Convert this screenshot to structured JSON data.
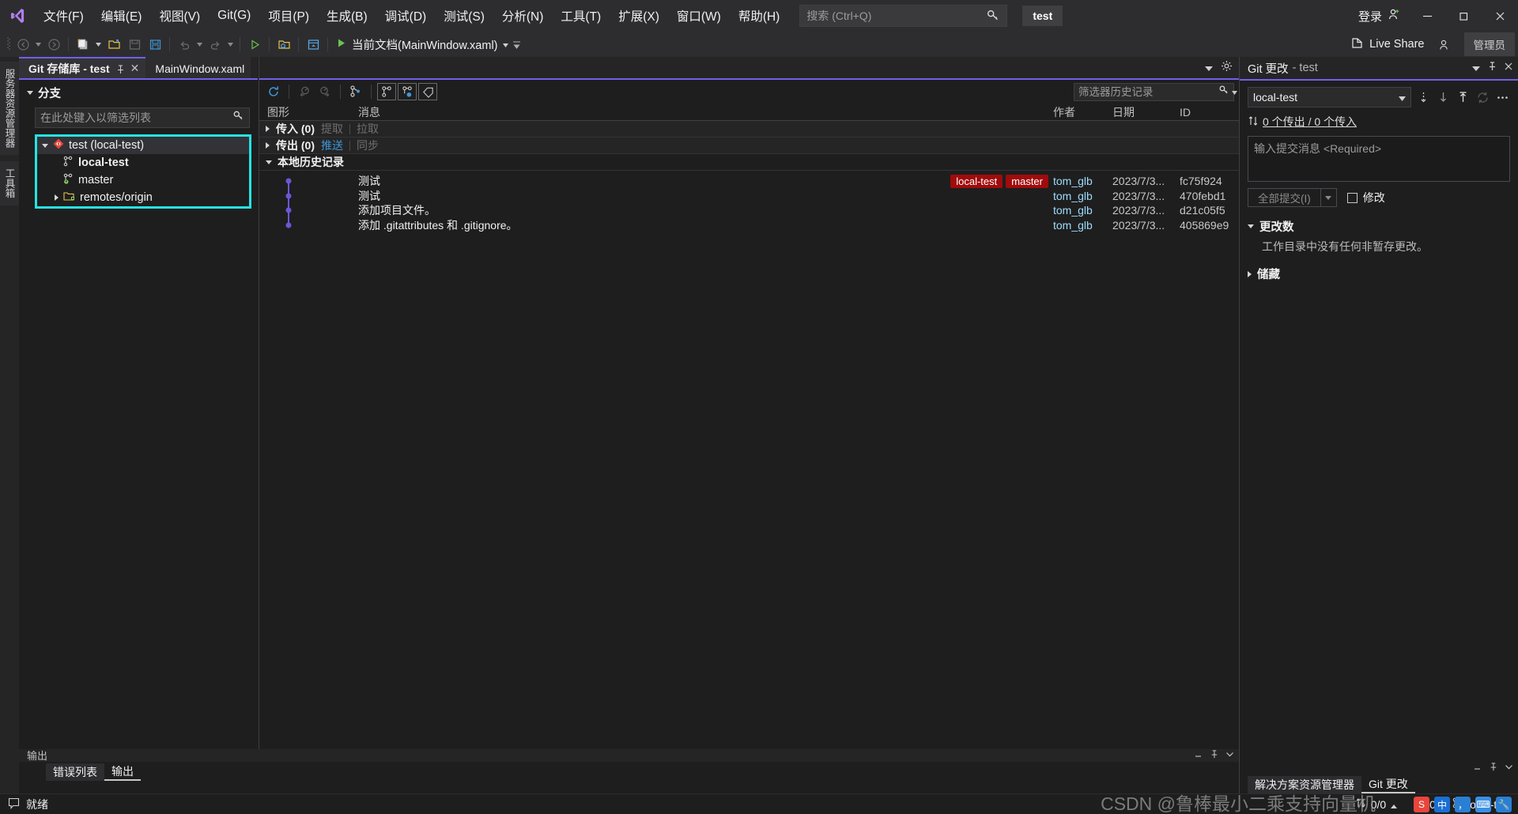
{
  "app": {
    "logo_icon": "visual-studio-logo",
    "project_chip": "test",
    "signin_label": "登录",
    "admin_label": "管理员",
    "live_share_label": "Live Share"
  },
  "menu": {
    "items": [
      {
        "label": "文件(F)"
      },
      {
        "label": "编辑(E)"
      },
      {
        "label": "视图(V)"
      },
      {
        "label": "Git(G)"
      },
      {
        "label": "项目(P)"
      },
      {
        "label": "生成(B)"
      },
      {
        "label": "调试(D)"
      },
      {
        "label": "测试(S)"
      },
      {
        "label": "分析(N)"
      },
      {
        "label": "工具(T)"
      },
      {
        "label": "扩展(X)"
      },
      {
        "label": "窗口(W)"
      },
      {
        "label": "帮助(H)"
      }
    ]
  },
  "search": {
    "placeholder": "搜索 (Ctrl+Q)",
    "value": "",
    "icon": "search-key-icon"
  },
  "window_controls": {
    "minimize": "minimize-icon",
    "restore": "restore-icon",
    "close": "close-icon"
  },
  "toolbar": {
    "startup_project": "当前文档(MainWindow.xaml)",
    "icons": [
      "navigate-back-icon",
      "navigate-forward-icon",
      "new-project-icon",
      "open-file-icon",
      "save-icon",
      "save-all-icon",
      "undo-icon",
      "redo-icon",
      "start-debug-icon",
      "folder-search-icon",
      "window-icon"
    ]
  },
  "vertical_dock": {
    "tabs": [
      "服务器资源管理器",
      "工具箱"
    ]
  },
  "doc_tabs": [
    {
      "label": "Git 存储库 - test",
      "active": true,
      "pinnable": true,
      "closable": true
    },
    {
      "label": "MainWindow.xaml",
      "active": false
    }
  ],
  "git_repo_pane": {
    "branches_section_label": "分支",
    "filter_placeholder": "在此处键入以筛选列表",
    "filter_value": "",
    "tree": [
      {
        "label": "test (local-test)",
        "level": 1,
        "icon": "git-repo-icon",
        "selected": true,
        "expanded": true
      },
      {
        "label": "local-test",
        "level": 2,
        "icon": "branch-icon",
        "bold": true
      },
      {
        "label": "master",
        "level": 2,
        "icon": "branch-remote-icon",
        "bold": false
      },
      {
        "label": "remotes/origin",
        "level": 2,
        "icon": "remote-folder-icon",
        "expanded": false
      }
    ]
  },
  "history_pane": {
    "filter_placeholder": "筛选器历史记录",
    "filter_value": "",
    "columns": {
      "graph": "图形",
      "message": "消息",
      "author": "作者",
      "date": "日期",
      "id": "ID"
    },
    "incoming": {
      "label": "传入 (0)",
      "actions": [
        {
          "label": "提取",
          "enabled": false
        },
        {
          "label": "拉取",
          "enabled": false
        }
      ]
    },
    "outgoing": {
      "label": "传出 (0)",
      "actions": [
        {
          "label": "推送",
          "enabled": true
        },
        {
          "label": "同步",
          "enabled": false
        }
      ]
    },
    "local_history_label": "本地历史记录",
    "commits": [
      {
        "message": "测试",
        "tags": [
          "local-test",
          "master"
        ],
        "author": "tom_glb",
        "date": "2023/7/3...",
        "id": "fc75f924"
      },
      {
        "message": "测试",
        "tags": [],
        "author": "tom_glb",
        "date": "2023/7/3...",
        "id": "470febd1"
      },
      {
        "message": "添加项目文件。",
        "tags": [],
        "author": "tom_glb",
        "date": "2023/7/3...",
        "id": "d21c05f5"
      },
      {
        "message": "添加 .gitattributes 和 .gitignore。",
        "tags": [],
        "author": "tom_glb",
        "date": "2023/7/3...",
        "id": "405869e9"
      }
    ]
  },
  "git_changes_pane": {
    "title_primary": "Git 更改",
    "title_secondary": "- test",
    "branch": "local-test",
    "sync_status": "0 个传出 / 0 个传入",
    "commit_message_placeholder": "输入提交消息 <Required>",
    "commit_message_value": "",
    "commit_all_label": "全部提交(I)",
    "amend_label": "修改",
    "amend_checked": false,
    "changes_section_label": "更改数",
    "changes_note": "工作目录中没有任何非暂存更改。",
    "stash_section_label": "储藏",
    "action_icons": [
      "fetch-icon",
      "pull-icon",
      "push-icon",
      "sync-icon",
      "more-options-icon"
    ]
  },
  "output_pane": {
    "label": "输出",
    "tabs": [
      {
        "label": "错误列表",
        "active": false
      },
      {
        "label": "输出",
        "active": true
      }
    ]
  },
  "right_bottom_tabs": [
    {
      "label": "解决方案资源管理器",
      "active": false
    },
    {
      "label": "Git 更改",
      "active": true
    }
  ],
  "status_bar": {
    "ready_label": "就绪",
    "sync_counts": "0/0",
    "pending_changes": "0",
    "branch": "local-test",
    "watermark": "CSDN @鲁棒最小二乘支持向量机",
    "ime_label": "中"
  },
  "colors": {
    "accent_purple": "#7160e8",
    "highlight_cyan": "#25e3e3",
    "tag_red": "#a00b0b",
    "link_blue": "#3f96d6",
    "graph_node": "#6b57d6"
  }
}
